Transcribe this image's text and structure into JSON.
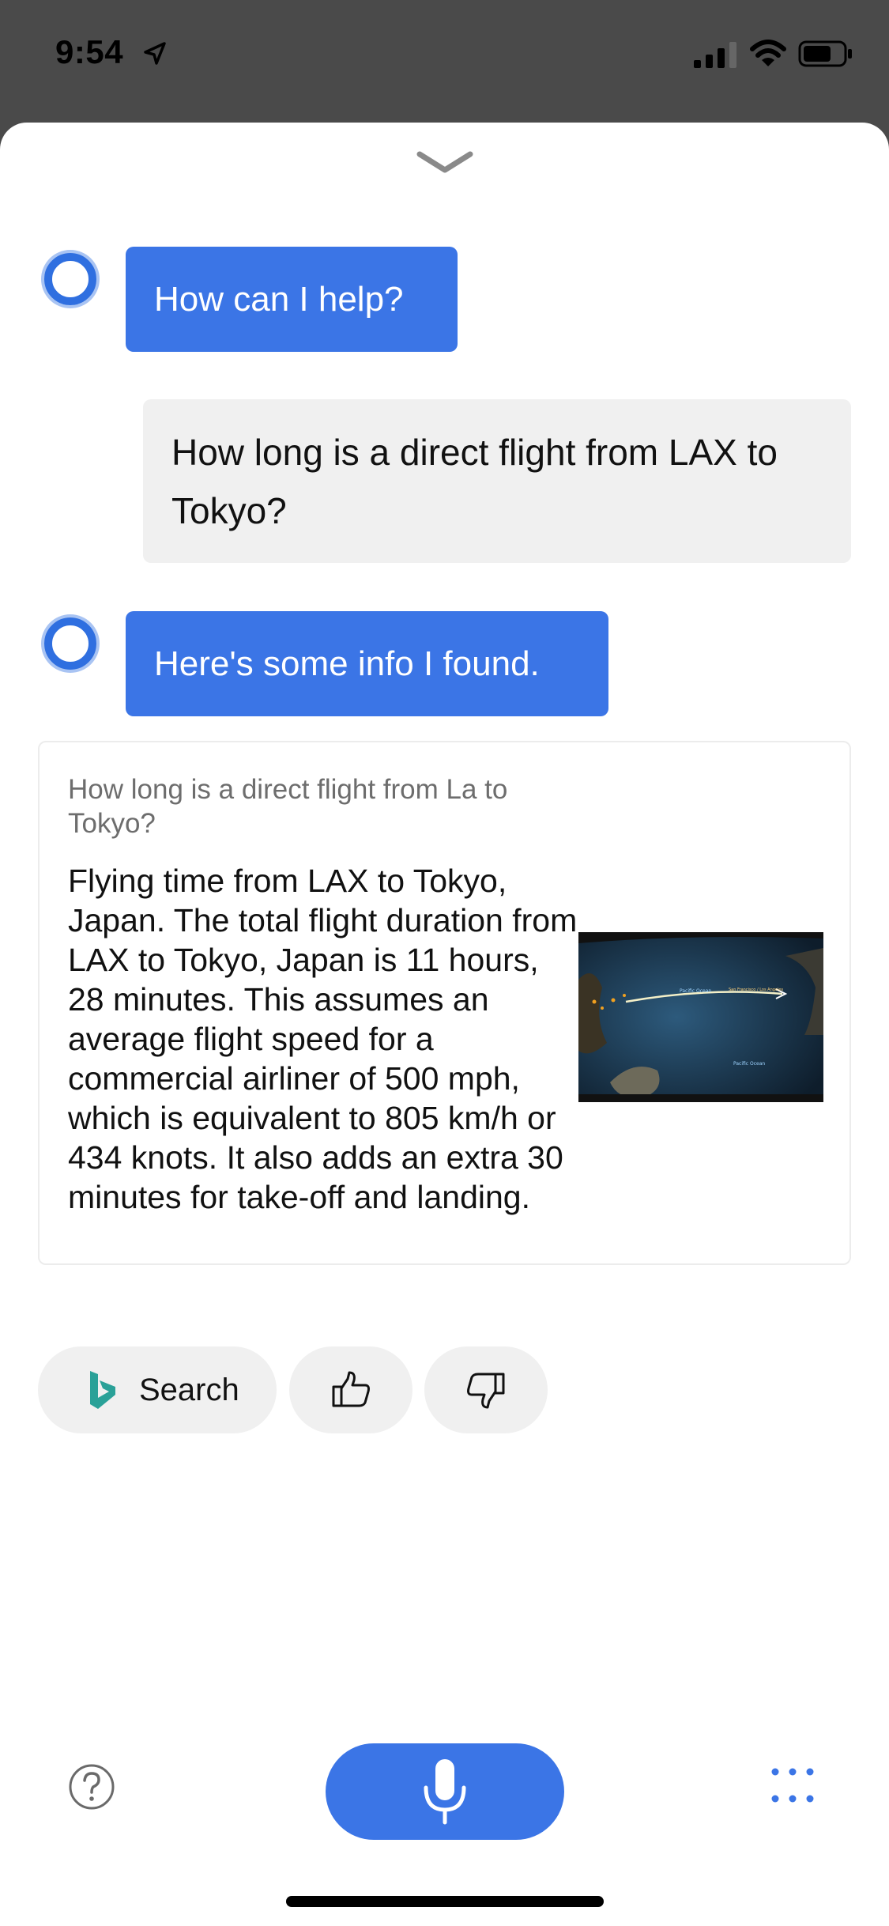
{
  "status_bar": {
    "time": "9:54",
    "icons": [
      "location-arrow-icon",
      "cellular-signal-icon",
      "wifi-icon",
      "battery-icon"
    ]
  },
  "sheet": {
    "collapse_icon": "chevron-down-icon"
  },
  "conversation": {
    "greeting": "How can I help?",
    "user_query": "How long is a direct flight from LAX to Tokyo?",
    "response_intro": "Here's some info I found."
  },
  "answer_card": {
    "question": "How long is a direct flight from La to Tokyo?",
    "body": "Flying time from LAX to Tokyo, Japan. The total flight duration from LAX to Tokyo, Japan is 11 hours, 28 minutes. This assumes an average flight speed for a commercial airliner of 500 mph, which is equivalent to 805 km/h or 434 knots. It also adds an extra 30 minutes for take-off and landing.",
    "image": {
      "label_pacific": "Pacific Ocean",
      "label_destinations": "San Francisco / Los Angeles",
      "label_pacific_lower": "Pacific Ocean"
    }
  },
  "actions": {
    "search_label": "Search",
    "search_icon": "bing-logo-icon",
    "like_icon": "thumbs-up-icon",
    "dislike_icon": "thumbs-down-icon"
  },
  "bottom_bar": {
    "help_icon": "help-icon",
    "mic_icon": "microphone-icon",
    "more_icon": "more-dots-icon"
  },
  "colors": {
    "accent": "#3b75e6",
    "status_bar_bg": "#4a4a4a",
    "bubble_user_bg": "#f0f0f0",
    "bing_teal": "#2aa198"
  }
}
